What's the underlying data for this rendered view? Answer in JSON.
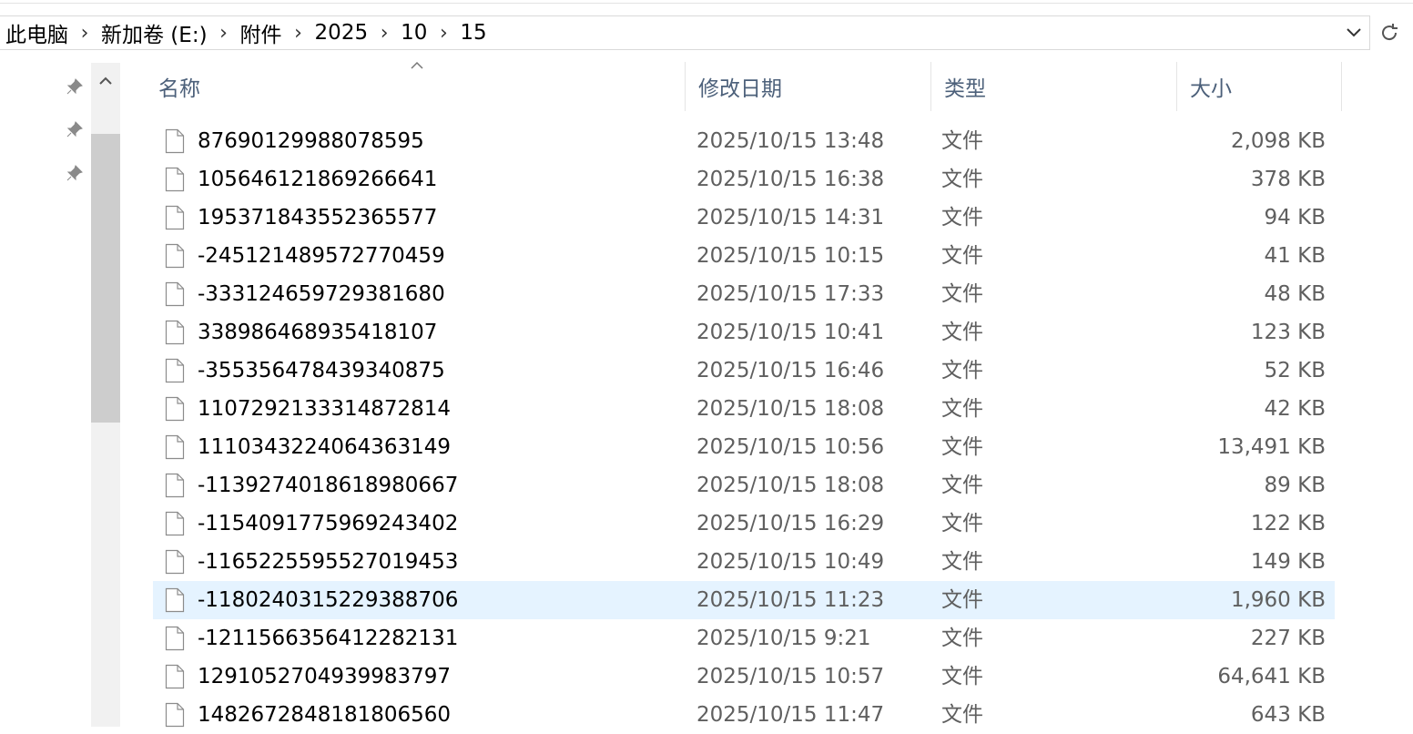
{
  "breadcrumb": [
    "此电脑",
    "新加卷 (E:)",
    "附件",
    "2025",
    "10",
    "15"
  ],
  "columns": {
    "name": "名称",
    "date": "修改日期",
    "type": "类型",
    "size": "大小"
  },
  "sort": {
    "column": "name",
    "direction": "ascending"
  },
  "selected_row_index": 12,
  "files": [
    {
      "name": "87690129988078595",
      "date": "2025/10/15 13:48",
      "type": "文件",
      "size": "2,098 KB"
    },
    {
      "name": "105646121869266641",
      "date": "2025/10/15 16:38",
      "type": "文件",
      "size": "378 KB"
    },
    {
      "name": "195371843552365577",
      "date": "2025/10/15 14:31",
      "type": "文件",
      "size": "94 KB"
    },
    {
      "name": "-245121489572770459",
      "date": "2025/10/15 10:15",
      "type": "文件",
      "size": "41 KB"
    },
    {
      "name": "-333124659729381680",
      "date": "2025/10/15 17:33",
      "type": "文件",
      "size": "48 KB"
    },
    {
      "name": "338986468935418107",
      "date": "2025/10/15 10:41",
      "type": "文件",
      "size": "123 KB"
    },
    {
      "name": "-355356478439340875",
      "date": "2025/10/15 16:46",
      "type": "文件",
      "size": "52 KB"
    },
    {
      "name": "1107292133314872814",
      "date": "2025/10/15 18:08",
      "type": "文件",
      "size": "42 KB"
    },
    {
      "name": "1110343224064363149",
      "date": "2025/10/15 10:56",
      "type": "文件",
      "size": "13,491 KB"
    },
    {
      "name": "-1139274018618980667",
      "date": "2025/10/15 18:08",
      "type": "文件",
      "size": "89 KB"
    },
    {
      "name": "-1154091775969243402",
      "date": "2025/10/15 16:29",
      "type": "文件",
      "size": "122 KB"
    },
    {
      "name": "-1165225595527019453",
      "date": "2025/10/15 10:49",
      "type": "文件",
      "size": "149 KB"
    },
    {
      "name": "-1180240315229388706",
      "date": "2025/10/15 11:23",
      "type": "文件",
      "size": "1,960 KB"
    },
    {
      "name": "-1211566356412282131",
      "date": "2025/10/15 9:21",
      "type": "文件",
      "size": "227 KB"
    },
    {
      "name": "1291052704939983797",
      "date": "2025/10/15 10:57",
      "type": "文件",
      "size": "64,641 KB"
    },
    {
      "name": "1482672848181806560",
      "date": "2025/10/15 11:47",
      "type": "文件",
      "size": "643 KB"
    }
  ],
  "icons": {
    "breadcrumb_separator": "chevron-right-icon",
    "dropdown": "chevron-down-icon",
    "refresh": "refresh-icon",
    "pin": "pin-icon",
    "file": "file-icon",
    "scroll_up": "chevron-up-icon"
  },
  "colors": {
    "selected_row": "#e5f3ff",
    "header_text": "#4c607a",
    "scroll_thumb": "#cdcdcd"
  }
}
